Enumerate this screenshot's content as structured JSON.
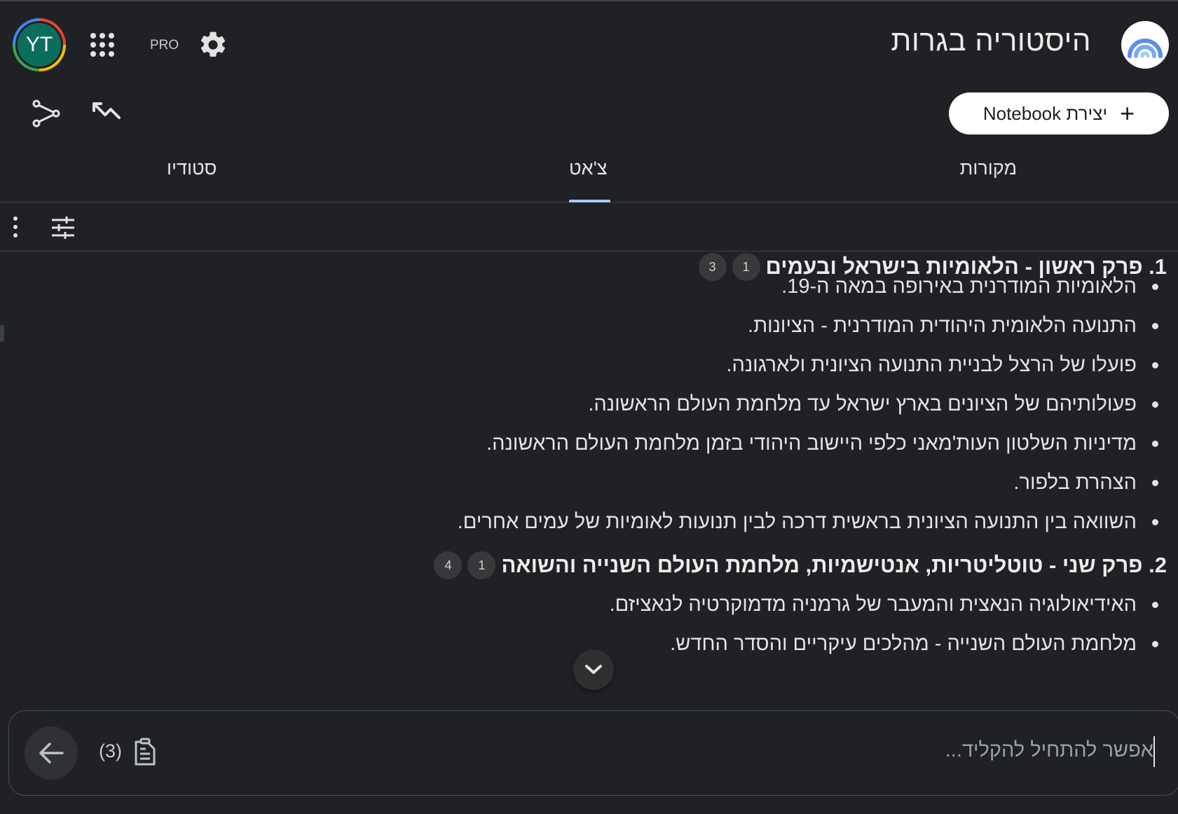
{
  "header": {
    "title": "היסטוריה בגרות",
    "avatar_initials": "YT",
    "pro_label": "PRO",
    "create_button_label": "יצירת Notebook"
  },
  "tabs": [
    {
      "label": "מקורות"
    },
    {
      "label": "צ'אט"
    },
    {
      "label": "סטודיו"
    }
  ],
  "active_tab": "צ'אט",
  "sections": [
    {
      "title": "1. פרק ראשון - הלאומיות בישראל ובעמים",
      "citations": [
        "1",
        "3"
      ],
      "items": [
        "הלאומיות המודרנית באירופה במאה ה-19.",
        "התנועה הלאומית היהודית המודרנית - הציונות.",
        "פועלו של הרצל לבניית התנועה הציונית ולארגונה.",
        "פעולותיהם של הציונים בארץ ישראל עד מלחמת העולם הראשונה.",
        "מדיניות השלטון העות'מאני כלפי היישוב היהודי בזמן מלחמת העולם הראשונה.",
        "הצהרת בלפור.",
        "השוואה בין התנועה הציונית בראשית דרכה לבין תנועות לאומיות של עמים אחרים."
      ]
    },
    {
      "title": "2. פרק שני - טוטליטריות, אנטישמיות, מלחמת העולם השנייה והשואה",
      "citations": [
        "1",
        "4"
      ],
      "items": [
        "האידיאולוגיה הנאצית והמעבר של גרמניה מדמוקרטיה לנאציזם.",
        "מלחמת העולם השנייה - מהלכים עיקריים והסדר החדש."
      ]
    }
  ],
  "input": {
    "placeholder": "אפשר להתחיל להקליד...",
    "source_count": "(3)"
  },
  "icons": {
    "logo": "notebooklm-logo-icon",
    "apps": "apps-grid-icon",
    "settings": "gear-icon",
    "share": "share-icon",
    "collapse": "collapse-icon",
    "more": "kebab-icon",
    "tune": "tune-icon",
    "scroll": "chevron-down-icon",
    "send": "arrow-left-icon",
    "sources": "document-icon"
  },
  "colors": {
    "background": "#202124",
    "accent": "#a8c7fa",
    "text": "#e3e3e3"
  }
}
